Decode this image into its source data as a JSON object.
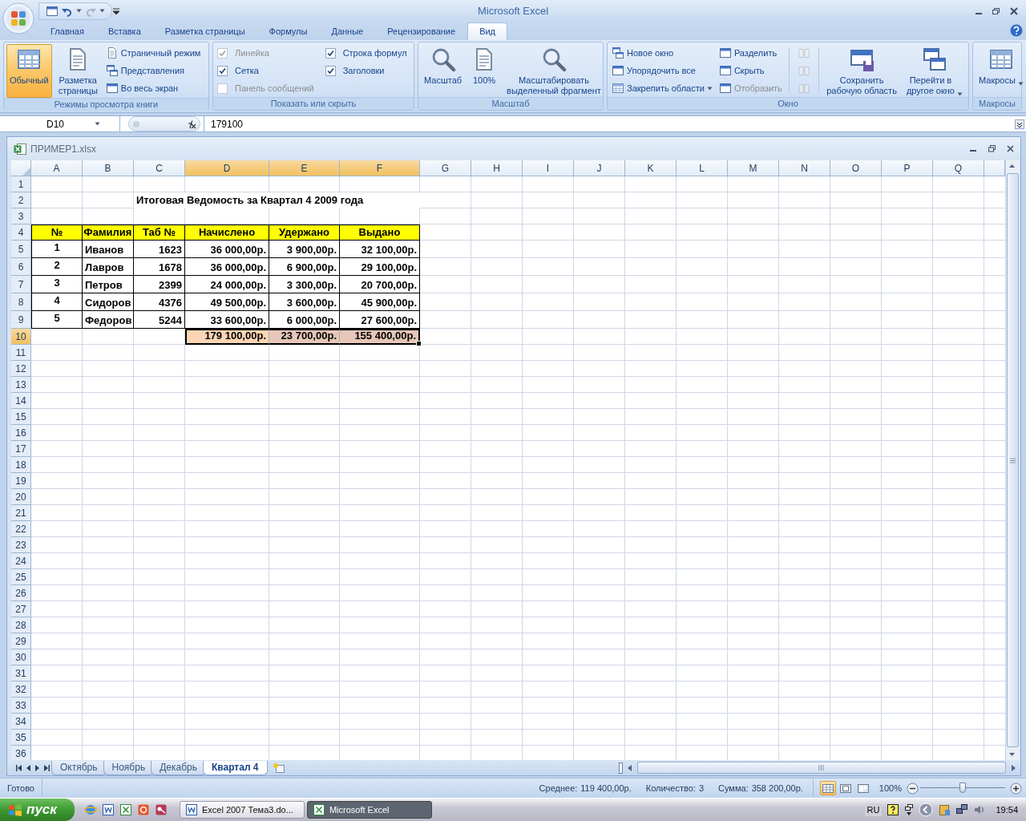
{
  "app_title": "Microsoft Excel",
  "ribbon_tabs": [
    {
      "label": "Главная",
      "selected": false
    },
    {
      "label": "Вставка",
      "selected": false
    },
    {
      "label": "Разметка страницы",
      "selected": false
    },
    {
      "label": "Формулы",
      "selected": false
    },
    {
      "label": "Данные",
      "selected": false
    },
    {
      "label": "Рецензирование",
      "selected": false
    },
    {
      "label": "Вид",
      "selected": true
    }
  ],
  "ribbon_groups": [
    {
      "label": "Режимы просмотра книги",
      "columns": [
        {
          "kind": "large",
          "label": "Обычный",
          "selected": true,
          "disabled": false,
          "dropdown": false
        },
        {
          "kind": "large",
          "label": "Разметка\nстраницы",
          "selected": false,
          "disabled": false,
          "dropdown": false
        },
        {
          "kind": "stack",
          "items": [
            {
              "kind": "button",
              "label": "Страничный режим",
              "selected": false,
              "disabled": false,
              "dropdown": false
            },
            {
              "kind": "button",
              "label": "Представления",
              "selected": false,
              "disabled": false,
              "dropdown": false
            },
            {
              "kind": "button",
              "label": "Во весь экран",
              "selected": false,
              "disabled": false,
              "dropdown": false
            }
          ]
        }
      ]
    },
    {
      "label": "Показать или скрыть",
      "columns": [
        {
          "kind": "stack",
          "items": [
            {
              "kind": "check",
              "label": "Линейка",
              "checked": true,
              "disabled": true
            },
            {
              "kind": "check",
              "label": "Сетка",
              "checked": true,
              "disabled": false
            },
            {
              "kind": "check",
              "label": "Панель сообщений",
              "checked": false,
              "disabled": true
            }
          ]
        },
        {
          "kind": "stack",
          "items": [
            {
              "kind": "check",
              "label": "Строка формул",
              "checked": true,
              "disabled": false
            },
            {
              "kind": "check",
              "label": "Заголовки",
              "checked": true,
              "disabled": false
            }
          ]
        }
      ]
    },
    {
      "label": "Масштаб",
      "columns": [
        {
          "kind": "large",
          "label": "Масштаб",
          "disabled": false,
          "dropdown": false
        },
        {
          "kind": "large",
          "label": "100%",
          "disabled": false,
          "dropdown": false
        },
        {
          "kind": "large",
          "label": "Масштабировать\nвыделенный фрагмент",
          "disabled": false,
          "dropdown": false
        }
      ]
    },
    {
      "label": "Окно",
      "columns": [
        {
          "kind": "stack",
          "items": [
            {
              "kind": "button",
              "label": "Новое окно",
              "disabled": false,
              "dropdown": false
            },
            {
              "kind": "button",
              "label": "Упорядочить все",
              "disabled": false,
              "dropdown": false
            },
            {
              "kind": "button",
              "label": "Закрепить области",
              "disabled": false,
              "dropdown": true
            }
          ]
        },
        {
          "kind": "stack",
          "items": [
            {
              "kind": "button",
              "label": "Разделить",
              "disabled": false,
              "dropdown": false
            },
            {
              "kind": "button",
              "label": "Скрыть",
              "disabled": false,
              "dropdown": false
            },
            {
              "kind": "button",
              "label": "Отобразить",
              "disabled": true,
              "dropdown": false
            }
          ]
        },
        {
          "kind": "stack",
          "items": [
            {
              "kind": "icon",
              "disabled": true
            },
            {
              "kind": "icon",
              "disabled": true
            },
            {
              "kind": "icon",
              "disabled": true
            }
          ]
        },
        {
          "kind": "large",
          "label": "Сохранить\nрабочую область",
          "disabled": false,
          "dropdown": false
        },
        {
          "kind": "large",
          "label": "Перейти в\nдругое окно",
          "disabled": false,
          "dropdown": true
        }
      ]
    },
    {
      "label": "Макросы",
      "columns": [
        {
          "kind": "large",
          "label": "Макросы",
          "disabled": false,
          "dropdown": true
        }
      ]
    }
  ],
  "formula_bar": {
    "name_box": "D10",
    "value": "179100"
  },
  "workbook": {
    "title": "ПРИМЕР1.xlsx",
    "column_headers": [
      {
        "label": "A",
        "selected": false
      },
      {
        "label": "B",
        "selected": false
      },
      {
        "label": "C",
        "selected": false
      },
      {
        "label": "D",
        "selected": true
      },
      {
        "label": "E",
        "selected": true
      },
      {
        "label": "F",
        "selected": true
      },
      {
        "label": "G",
        "selected": false
      },
      {
        "label": "H",
        "selected": false
      },
      {
        "label": "I",
        "selected": false
      },
      {
        "label": "J",
        "selected": false
      },
      {
        "label": "K",
        "selected": false
      },
      {
        "label": "L",
        "selected": false
      },
      {
        "label": "M",
        "selected": false
      },
      {
        "label": "N",
        "selected": false
      },
      {
        "label": "O",
        "selected": false
      },
      {
        "label": "P",
        "selected": false
      },
      {
        "label": "Q",
        "selected": false
      }
    ],
    "row_headers": [
      {
        "label": "1",
        "selected": false
      },
      {
        "label": "2",
        "selected": false
      },
      {
        "label": "3",
        "selected": false
      },
      {
        "label": "4",
        "selected": false
      },
      {
        "label": "5",
        "selected": false
      },
      {
        "label": "6",
        "selected": false
      },
      {
        "label": "7",
        "selected": false
      },
      {
        "label": "8",
        "selected": false
      },
      {
        "label": "9",
        "selected": false
      },
      {
        "label": "10",
        "selected": true
      },
      {
        "label": "11",
        "selected": false
      },
      {
        "label": "12",
        "selected": false
      },
      {
        "label": "13",
        "selected": false
      },
      {
        "label": "14",
        "selected": false
      },
      {
        "label": "15",
        "selected": false
      },
      {
        "label": "16",
        "selected": false
      },
      {
        "label": "17",
        "selected": false
      },
      {
        "label": "18",
        "selected": false
      },
      {
        "label": "19",
        "selected": false
      },
      {
        "label": "20",
        "selected": false
      },
      {
        "label": "21",
        "selected": false
      },
      {
        "label": "22",
        "selected": false
      },
      {
        "label": "23",
        "selected": false
      },
      {
        "label": "24",
        "selected": false
      },
      {
        "label": "25",
        "selected": false
      },
      {
        "label": "26",
        "selected": false
      },
      {
        "label": "27",
        "selected": false
      },
      {
        "label": "28",
        "selected": false
      },
      {
        "label": "29",
        "selected": false
      },
      {
        "label": "30",
        "selected": false
      },
      {
        "label": "31",
        "selected": false
      },
      {
        "label": "32",
        "selected": false
      },
      {
        "label": "33",
        "selected": false
      },
      {
        "label": "34",
        "selected": false
      },
      {
        "label": "35",
        "selected": false
      },
      {
        "label": "36",
        "selected": false
      }
    ],
    "sheet_title": "Итоговая Ведомость за Квартал 4 2009 года",
    "table": {
      "header": [
        "№",
        "Фамилия",
        "Таб №",
        "Начислено",
        "Удержано",
        "Выдано"
      ],
      "rows": [
        [
          "1",
          "Иванов",
          "1623",
          "36 000,00р.",
          "3 900,00р.",
          "32 100,00р."
        ],
        [
          "2",
          "Лавров",
          "1678",
          "36 000,00р.",
          "6 900,00р.",
          "29 100,00р."
        ],
        [
          "3",
          "Петров",
          "2399",
          "24 000,00р.",
          "3 300,00р.",
          "20 700,00р."
        ],
        [
          "4",
          "Сидоров",
          "4376",
          "49 500,00р.",
          "3 600,00р.",
          "45 900,00р."
        ],
        [
          "5",
          "Федоров",
          "5244",
          "33 600,00р.",
          "6 000,00р.",
          "27 600,00р."
        ]
      ],
      "totals": [
        {
          "text": "179 100,00р.",
          "selected": true,
          "active": true
        },
        {
          "text": "23 700,00р.",
          "selected": true,
          "active": false
        },
        {
          "text": "155 400,00р.",
          "selected": true,
          "active": false
        }
      ]
    },
    "sheet_tabs": [
      {
        "label": "Октябрь",
        "selected": false
      },
      {
        "label": "Ноябрь",
        "selected": false
      },
      {
        "label": "Декабрь",
        "selected": false
      },
      {
        "label": "Квартал 4",
        "selected": true
      }
    ]
  },
  "status_bar": {
    "mode": "Готово",
    "stats": [
      {
        "label": "Среднее:",
        "value": "119 400,00р."
      },
      {
        "label": "Количество:",
        "value": "3"
      },
      {
        "label": "Сумма:",
        "value": "358 200,00р."
      }
    ],
    "views": [
      {
        "selected": true
      },
      {
        "selected": false
      },
      {
        "selected": false
      }
    ],
    "zoom": "100%",
    "zoom_slider": {
      "level": 0.5
    }
  },
  "taskbar": {
    "start": "пуск",
    "tasks": [
      {
        "label": "Excel 2007 Тема3.do...",
        "selected": false
      },
      {
        "label": "Microsoft Excel",
        "selected": true
      }
    ],
    "language": "RU",
    "clock": "19:54"
  }
}
